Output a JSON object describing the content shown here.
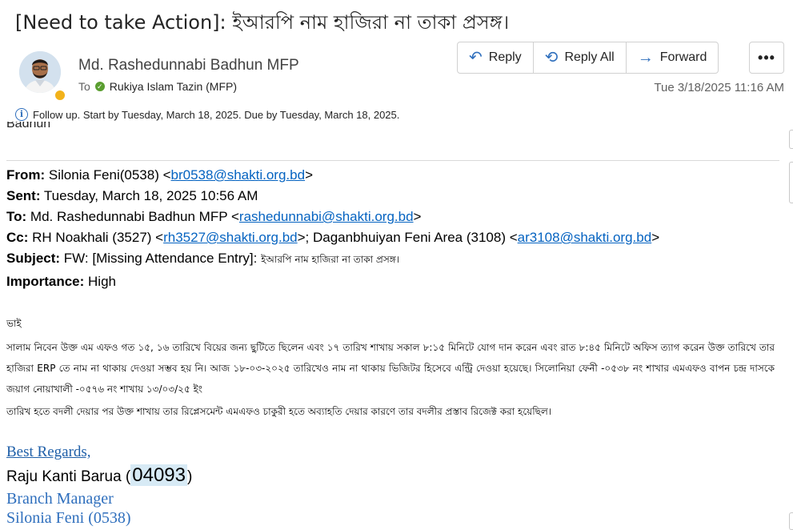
{
  "subject": "[Need to take Action]: ইআরপি   নাম হাজিরা না তাকা প্রসঙ্গ।",
  "sender": {
    "name": "Md. Rashedunnabi Badhun MFP",
    "to_label": "To",
    "recipient": "Rukiya Islam Tazin (MFP)"
  },
  "actions": {
    "reply": "Reply",
    "reply_all": "Reply All",
    "forward": "Forward",
    "more": "•••"
  },
  "date": "Tue 3/18/2025 11:16 AM",
  "followup": "Follow up.  Start by Tuesday, March 18, 2025.  Due by Tuesday, March 18, 2025.",
  "cut_text": "Badhun",
  "forwarded": {
    "from_label": "From:",
    "from_name": "Silonia Feni(0538) <",
    "from_email": "br0538@shakti.org.bd",
    "from_end": ">",
    "sent_label": "Sent:",
    "sent": "Tuesday, March 18, 2025 10:56 AM",
    "to_label": "To:",
    "to_name": "Md. Rashedunnabi Badhun MFP <",
    "to_email": "rashedunnabi@shakti.org.bd",
    "to_end": ">",
    "cc_label": "Cc:",
    "cc_name1": "RH Noakhali (3527) <",
    "cc_email1": "rh3527@shakti.org.bd",
    "cc_mid": ">; Daganbhuiyan Feni Area (3108) <",
    "cc_email2": "ar3108@shakti.org.bd",
    "cc_end": ">",
    "subject_label": "Subject:",
    "subject_prefix": "FW: [Missing Attendance Entry]: ",
    "subject_bn": "ইআরপি নাম হাজিরা না তাকা প্রসঙ্গ।",
    "importance_label": "Importance:",
    "importance": "High"
  },
  "body": {
    "greeting": "ভাই",
    "paragraph": "সালাম নিবেন উক্ত এম এফও গত ১৫, ১৬ তারিখে বিয়ের জন্য  ছুটিতে ছিলেন এবং ১৭ তারিখ শাখায় সকাল ৮:১৫ মিনিটে যোগ দান করেন এবং রাত ৮:৪৫ মিনিটে অফিস ত্যাগ করেন উক্ত তারিখে তার হাজিরা ERP তে নাম না থাকায় দেওয়া সম্ভব হয় নি। আজ ১৮-০৩-২০২৫ তারিখেও নাম না থাকায় ভিজিটর হিসেবে এন্ট্রি দেওয়া হয়েছে।  সিলোনিয়া ফেনী -০৫৩৮ নং শাখার এমএফও বাপন চন্দ্র দাসকে জয়াগ নোয়াখালী -০৫৭৬ নং শাখায় ১৩/০৩/২৫ ইং",
    "paragraph2": " তারিখ হতে বদলী দেয়ার পর উক্ত শাখায় তার রিপ্লেসমেন্ট এমএফও চাকুরী হতে অব্যাহতি দেয়ার কারণে তার বদলীর প্রস্তাব রিজেক্ট করা হয়েছিল।"
  },
  "signature": {
    "regards": "Best Regards,",
    "name": "Raju Kanti Barua (",
    "id": "04093",
    "name_end": ")",
    "title": "Branch Manager",
    "branch": "Silonia Feni (0538)"
  }
}
